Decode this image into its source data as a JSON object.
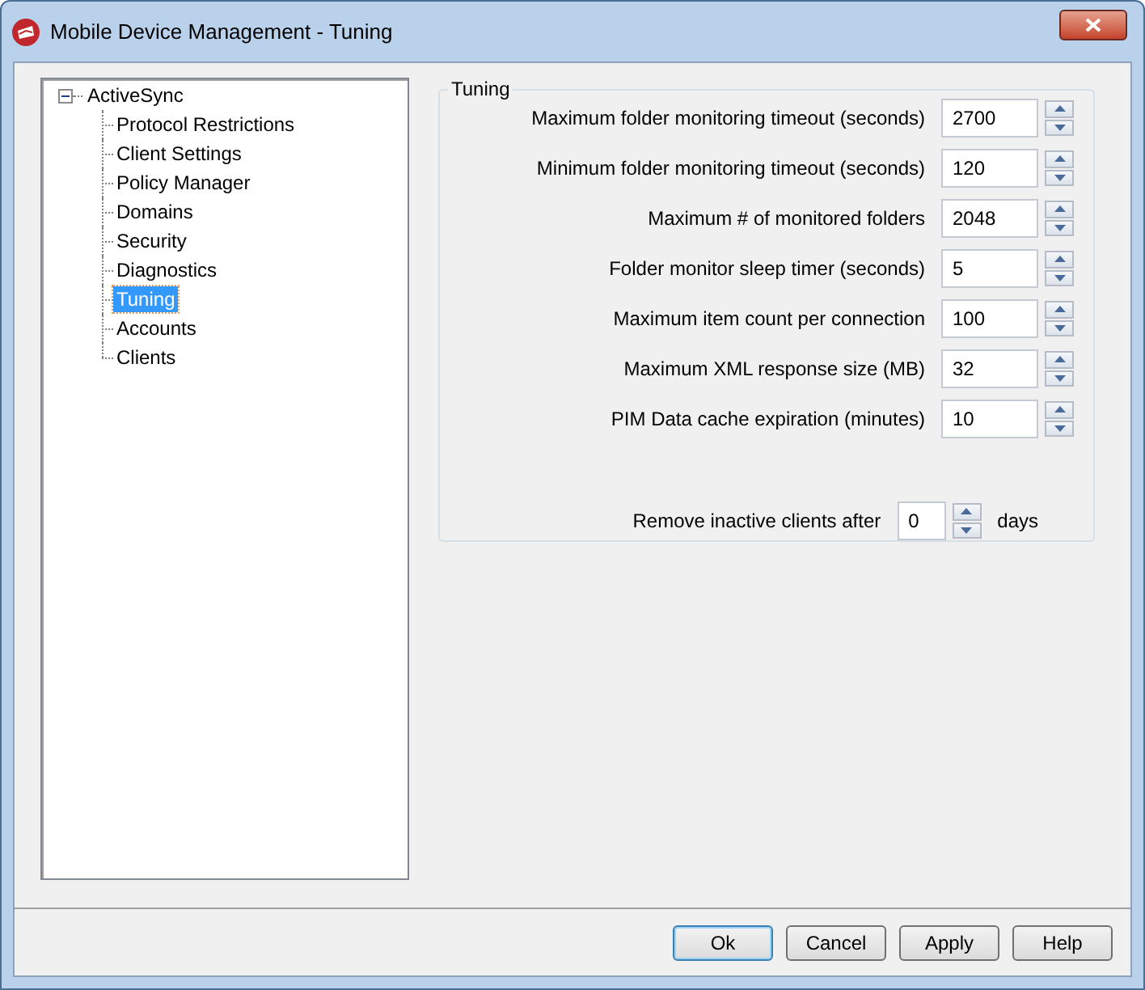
{
  "window": {
    "title": "Mobile Device Management - Tuning"
  },
  "tree": [
    {
      "label": "ActiveSync",
      "expanded": true,
      "selected": false,
      "children": [
        {
          "label": "Protocol Restrictions",
          "selected": false
        },
        {
          "label": "Client Settings",
          "selected": false
        },
        {
          "label": "Policy Manager",
          "selected": false
        },
        {
          "label": "Domains",
          "selected": false
        },
        {
          "label": "Security",
          "selected": false
        },
        {
          "label": "Diagnostics",
          "selected": false
        },
        {
          "label": "Tuning",
          "selected": true
        },
        {
          "label": "Accounts",
          "selected": false
        },
        {
          "label": "Clients",
          "selected": false
        }
      ]
    }
  ],
  "group": {
    "title": "Tuning",
    "settings": [
      {
        "label": "Maximum folder monitoring timeout (seconds)",
        "value": "2700"
      },
      {
        "label": "Minimum folder monitoring timeout (seconds)",
        "value": "120"
      },
      {
        "label": "Maximum # of monitored folders",
        "value": "2048"
      },
      {
        "label": "Folder monitor sleep timer (seconds)",
        "value": "5"
      },
      {
        "label": "Maximum item count per connection",
        "value": "100"
      },
      {
        "label": "Maximum XML response size (MB)",
        "value": "32"
      },
      {
        "label": "PIM Data cache expiration (minutes)",
        "value": "10"
      }
    ],
    "inactive": {
      "label": "Remove inactive clients after",
      "value": "0",
      "suffix": "days"
    }
  },
  "buttons": [
    {
      "label": "Ok",
      "default": true
    },
    {
      "label": "Cancel",
      "default": false
    },
    {
      "label": "Apply",
      "default": false
    },
    {
      "label": "Help",
      "default": false
    }
  ]
}
